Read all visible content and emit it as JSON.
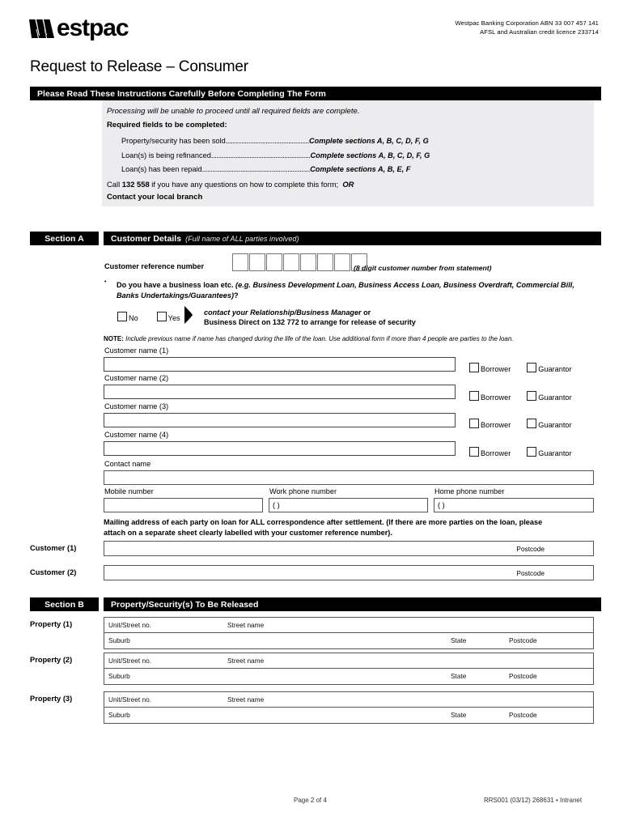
{
  "header": {
    "logo_text": "estpac",
    "logo_icon": "westpac-w-logo",
    "corporate_line1": "Westpac Banking Corporation ABN 33 007 457 141",
    "corporate_line2": "AFSL and Australian credit licence 233714"
  },
  "title": "Request to Release – Consumer",
  "instructions": {
    "bar_title": "Please Read These Instructions Carefully Before Completing The Form",
    "intro": "Processing will be unable to proceed until all required fields are complete.",
    "required_heading": "Required fields to be completed:",
    "rows": [
      {
        "label": "Property/security has been sold",
        "dots": "................................................",
        "answer": "Complete sections A, B, C, D, F, G"
      },
      {
        "label": "Loan(s) is being refinanced",
        "dots": ".........................................................",
        "answer": "Complete sections A, B, C, D, F, G"
      },
      {
        "label": "Loan(s) has been repaid",
        "dots": "..............................................................",
        "answer": "Complete sections A, B, E, F"
      }
    ],
    "call_prefix": "Call ",
    "call_number": "132 558",
    "call_suffix": " if you have any questions on how to complete this form;",
    "call_or": "OR",
    "branch": "Contact your local branch"
  },
  "section_a": {
    "tag": "Section A",
    "heading": "Customer Details",
    "heading_sub": "(Full name of ALL parties involved)",
    "crn_label": "Customer reference number",
    "crn_boxes": 8,
    "crn_hint": "(8 digit customer number from statement)",
    "business_bullet": "•",
    "business_q_plain": "Do you have a business loan etc. ",
    "business_q_italic": "(e.g. Business Development Loan, Business Access Loan, Business Overdraft, Commercial Bill,",
    "business_q_italic2": "Banks Undertakings/Guarantees)",
    "business_q_end": "?",
    "option_no": "No",
    "option_yes": "Yes",
    "arrow_icon": "right-arrow-icon",
    "contact_mgr_italic": "contact your Relationship/Business Manager ",
    "contact_mgr_or": "or",
    "business_direct_pre": "Business Direct on ",
    "business_direct_num": "132 772",
    "business_direct_post": " to arrange for release of security",
    "note_label": "NOTE:",
    "note_text": "Include previous name if name has changed during the life of the loan. Use additional form if more than 4 people are parties to the loan.",
    "customer_names": [
      {
        "label": "Customer name (1)",
        "value": "",
        "borrower": "Borrower",
        "guarantor": "Guarantor"
      },
      {
        "label": "Customer name (2)",
        "value": "",
        "borrower": "Borrower",
        "guarantor": "Guarantor"
      },
      {
        "label": "Customer name (3)",
        "value": "",
        "borrower": "Borrower",
        "guarantor": "Guarantor"
      },
      {
        "label": "Customer name (4)",
        "value": "",
        "borrower": "Borrower",
        "guarantor": "Guarantor"
      }
    ],
    "contact_name_label": "Contact name",
    "contact_name_value": "",
    "mobile_label": "Mobile number",
    "mobile_value": "",
    "work_label": "Work phone number",
    "work_value": "(          )",
    "home_label": "Home phone number",
    "home_value": "(          )",
    "mailing_text_1": "Mailing address of each party on loan for ",
    "mailing_bold": "ALL",
    "mailing_text_2": " correspondence after settlement. (If there are more parties on the loan, please",
    "mailing_text_3": "attach on a separate sheet clearly labelled with your customer reference number).",
    "address_rows": [
      {
        "side_label": "Customer (1)",
        "value": "",
        "postcode_label": "Postcode",
        "postcode_value": ""
      },
      {
        "side_label": "Customer (2)",
        "value": "",
        "postcode_label": "Postcode",
        "postcode_value": ""
      }
    ]
  },
  "section_b": {
    "tag": "Section B",
    "heading": "Property/Security(s) To Be Released",
    "col_unit": "Unit/Street no.",
    "col_street": "Street name",
    "col_suburb": "Suburb",
    "col_state": "State",
    "col_postcode": "Postcode",
    "properties": [
      {
        "side_label": "Property (1)",
        "unit": "",
        "street": "",
        "suburb": "",
        "state": "",
        "postcode": ""
      },
      {
        "side_label": "Property (2)",
        "unit": "",
        "street": "",
        "suburb": "",
        "state": "",
        "postcode": ""
      },
      {
        "side_label": "Property (3)",
        "unit": "",
        "street": "",
        "suburb": "",
        "state": "",
        "postcode": ""
      }
    ]
  },
  "footer": {
    "page": "Page 2 of 4",
    "ref": "RRS001  (03/12) 268631 • Intranet"
  }
}
